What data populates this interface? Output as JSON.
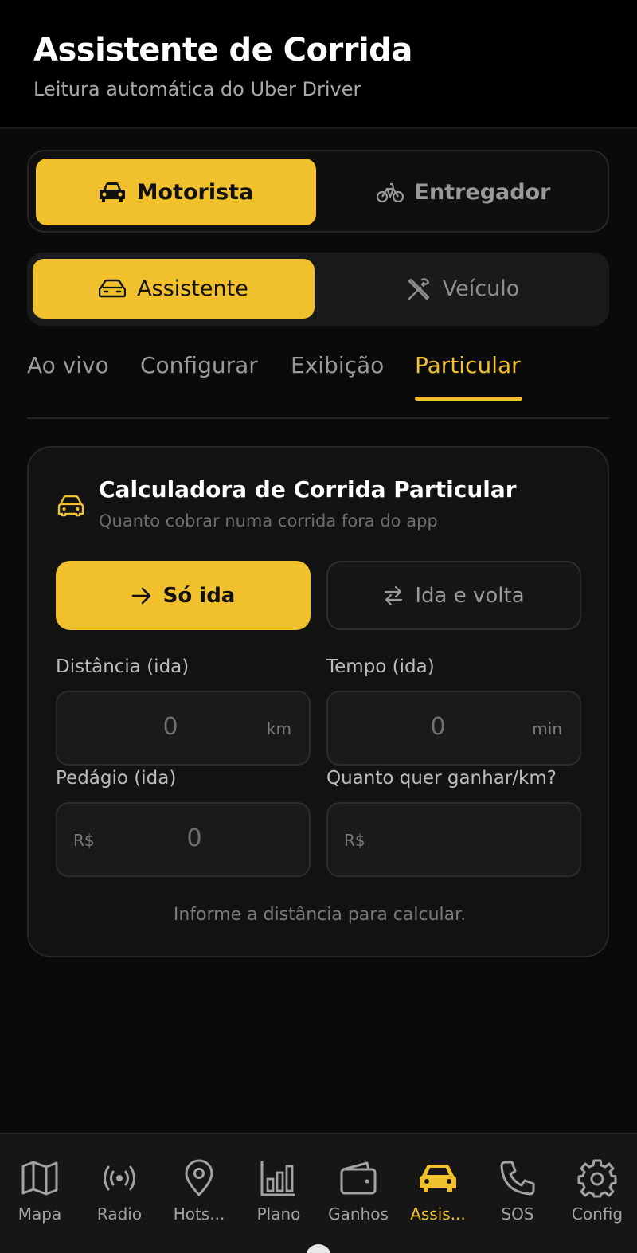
{
  "header": {
    "title": "Assistente de Corrida",
    "subtitle": "Leitura automática do Uber Driver"
  },
  "role_toggle": {
    "options": [
      {
        "label": "Motorista",
        "icon": "car-icon",
        "active": true
      },
      {
        "label": "Entregador",
        "icon": "bicycle-icon",
        "active": false
      }
    ]
  },
  "mode_toggle": {
    "options": [
      {
        "label": "Assistente",
        "icon": "car-outline-icon",
        "active": true
      },
      {
        "label": "Veículo",
        "icon": "tools-icon",
        "active": false
      }
    ]
  },
  "tabs": [
    {
      "label": "Ao vivo",
      "active": false
    },
    {
      "label": "Configurar",
      "active": false
    },
    {
      "label": "Exibição",
      "active": false
    },
    {
      "label": "Particular",
      "active": true
    }
  ],
  "calculator": {
    "title": "Calculadora de Corrida Particular",
    "subtitle": "Quanto cobrar numa corrida fora do app",
    "trip_options": [
      {
        "label": "Só ida",
        "icon": "arrow-right-icon",
        "active": true
      },
      {
        "label": "Ida e volta",
        "icon": "swap-arrows-icon",
        "active": false
      }
    ],
    "fields": {
      "distance": {
        "label": "Distância (ida)",
        "placeholder": "0",
        "unit": "km"
      },
      "time": {
        "label": "Tempo (ida)",
        "placeholder": "0",
        "unit": "min"
      },
      "toll": {
        "label": "Pedágio (ida)",
        "prefix": "R$",
        "placeholder": "0"
      },
      "earn_per_km": {
        "label": "Quanto quer ganhar/km?",
        "prefix": "R$",
        "placeholder": ""
      }
    },
    "hint": "Informe a distância para calcular."
  },
  "bottom_nav": {
    "items": [
      {
        "label": "Mapa",
        "icon": "map-icon",
        "active": false
      },
      {
        "label": "Radio",
        "icon": "radio-icon",
        "active": false
      },
      {
        "label": "Hots...",
        "icon": "location-pin-icon",
        "active": false
      },
      {
        "label": "Plano",
        "icon": "bar-chart-icon",
        "active": false
      },
      {
        "label": "Ganhos",
        "icon": "wallet-icon",
        "active": false
      },
      {
        "label": "Assis...",
        "icon": "car-icon",
        "active": true
      },
      {
        "label": "SOS",
        "icon": "phone-icon",
        "active": false
      },
      {
        "label": "Config",
        "icon": "gear-icon",
        "active": false
      }
    ]
  },
  "colors": {
    "accent": "#f0c12d",
    "background": "#0a0a0a",
    "card": "#121212"
  }
}
